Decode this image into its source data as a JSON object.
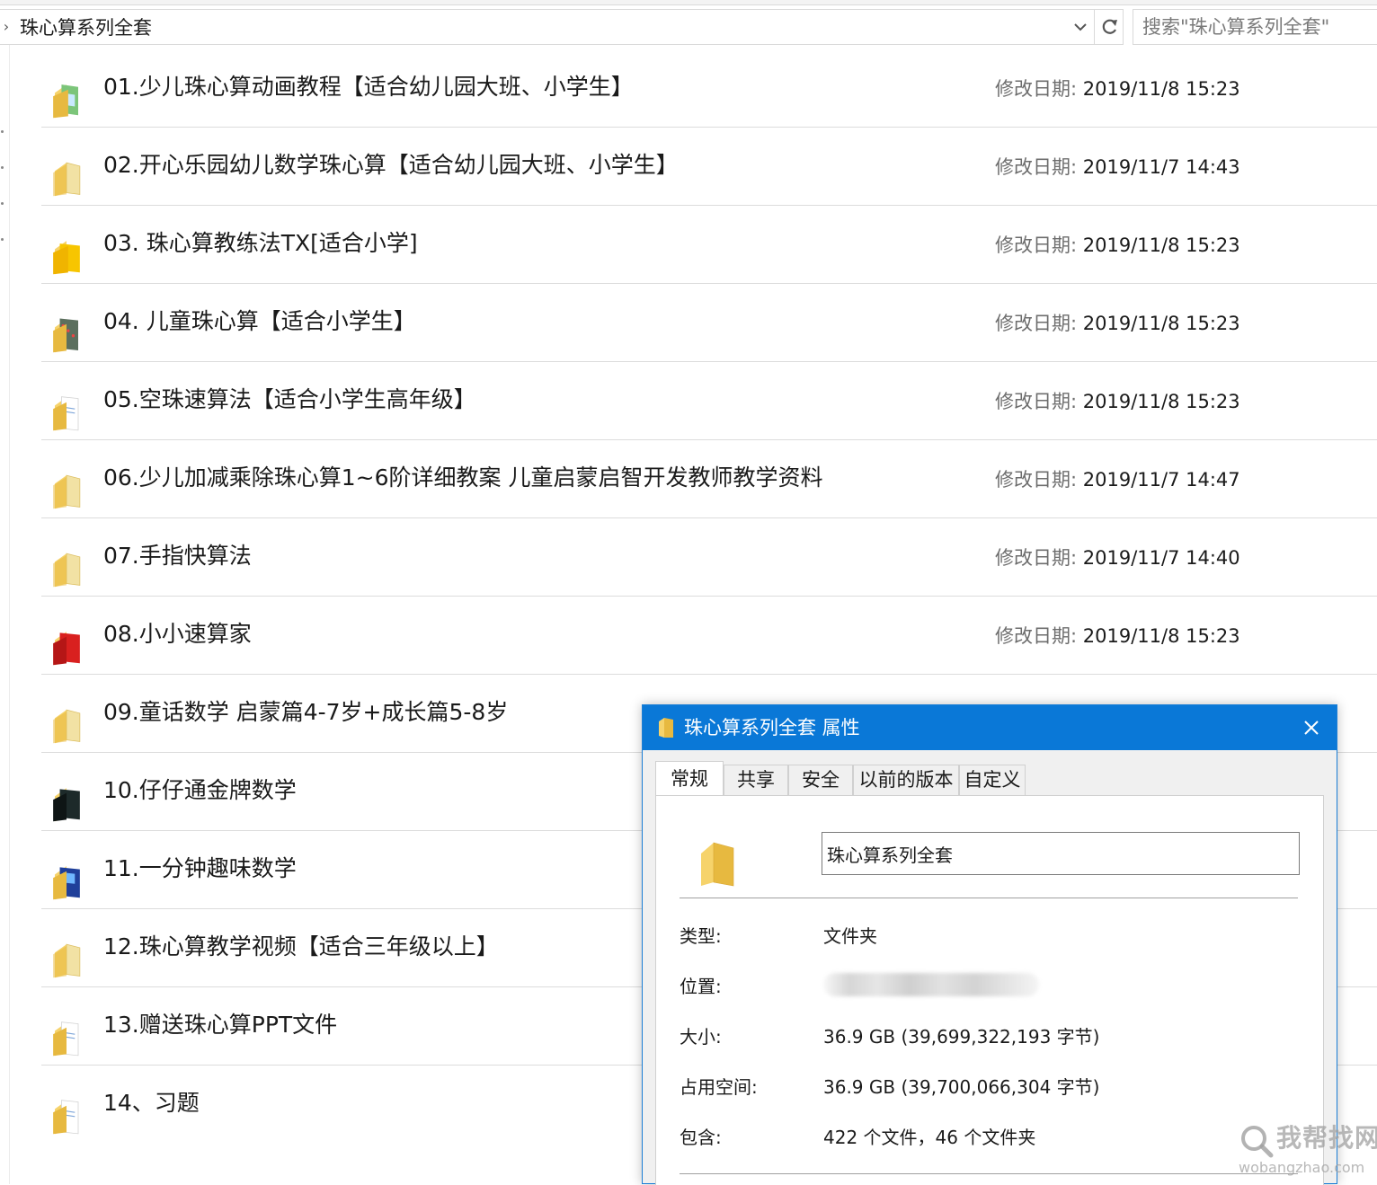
{
  "address": {
    "path": "珠心算系列全套"
  },
  "search": {
    "placeholder": "搜索\"珠心算系列全套\""
  },
  "date_label": "修改日期:",
  "folders": [
    {
      "name": "01.少儿珠心算动画教程【适合幼儿园大班、小学生】",
      "date": "2019/11/8 15:23",
      "icon": "folder-thumb-green-icon"
    },
    {
      "name": "02.开心乐园幼儿数学珠心算【适合幼儿园大班、小学生】",
      "date": "2019/11/7 14:43",
      "icon": "folder-icon"
    },
    {
      "name": "03. 珠心算教练法TX[适合小学]",
      "date": "2019/11/8 15:23",
      "icon": "folder-thumb-yellow-icon"
    },
    {
      "name": "04. 儿童珠心算【适合小学生】",
      "date": "2019/11/8 15:23",
      "icon": "folder-thumb-abacus-icon"
    },
    {
      "name": "05.空珠速算法【适合小学生高年级】",
      "date": "2019/11/8 15:23",
      "icon": "folder-thumb-doc-icon"
    },
    {
      "name": "06.少儿加减乘除珠心算1~6阶详细教案 儿童启蒙启智开发教师教学资料",
      "date": "2019/11/7 14:47",
      "icon": "folder-icon"
    },
    {
      "name": "07.手指快算法",
      "date": "2019/11/7 14:40",
      "icon": "folder-icon"
    },
    {
      "name": "08.小小速算家",
      "date": "2019/11/8 15:23",
      "icon": "folder-thumb-red-icon"
    },
    {
      "name": "09.童话数学 启蒙篇4-7岁+成长篇5-8岁",
      "date": "",
      "icon": "folder-icon"
    },
    {
      "name": "10.仔仔通金牌数学",
      "date": "",
      "icon": "folder-thumb-dark-icon"
    },
    {
      "name": "11.一分钟趣味数学",
      "date": "",
      "icon": "folder-thumb-blue-icon"
    },
    {
      "name": "12.珠心算教学视频【适合三年级以上】",
      "date": "",
      "icon": "folder-icon"
    },
    {
      "name": "13.赠送珠心算PPT文件",
      "date": "",
      "icon": "folder-thumb-doc-icon"
    },
    {
      "name": "14、习题",
      "date": "",
      "icon": "folder-thumb-doc-icon"
    }
  ],
  "dialog": {
    "title": "珠心算系列全套 属性",
    "tabs": [
      "常规",
      "共享",
      "安全",
      "以前的版本",
      "自定义"
    ],
    "folder_name": "珠心算系列全套",
    "props": {
      "type_label": "类型:",
      "type_value": "文件夹",
      "location_label": "位置:",
      "size_label": "大小:",
      "size_value": "36.9 GB (39,699,322,193 字节)",
      "disk_label": "占用空间:",
      "disk_value": "36.9 GB (39,700,066,304 字节)",
      "contains_label": "包含:",
      "contains_value": "422 个文件，46 个文件夹"
    }
  },
  "watermark": {
    "cn": "我帮找网",
    "en": "wobangzhao.com"
  },
  "colors": {
    "accent": "#0a78d7",
    "folder": "#f6d36b",
    "folder_dark": "#e7b940"
  }
}
